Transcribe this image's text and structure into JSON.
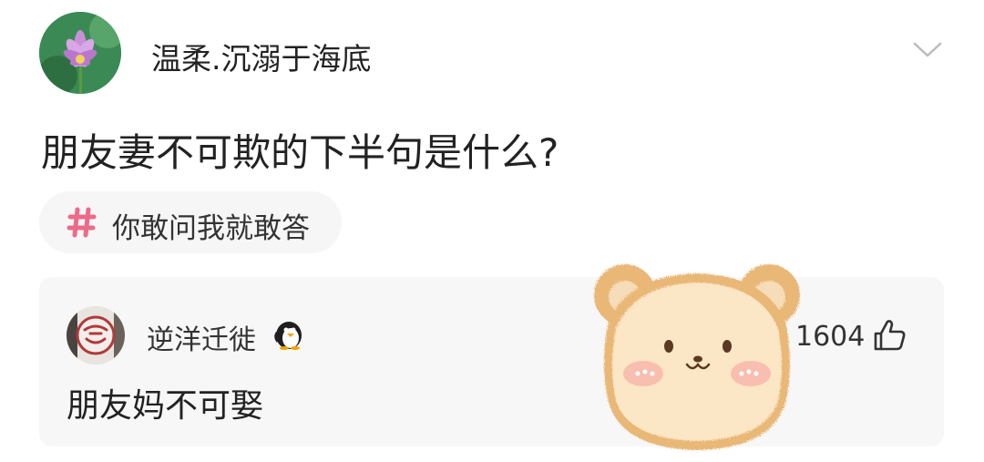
{
  "post": {
    "author": "温柔.沉溺于海底",
    "avatar_icon": "lotus-avatar",
    "question": "朋友妻不可欺的下半句是什么?",
    "topic": {
      "hash_icon": "hash-icon",
      "label": "你敢问我就敢答",
      "accent_color": "#ec6b8b"
    }
  },
  "comment": {
    "author": "逆洋迁徙",
    "avatar_icon": "stamp-avatar",
    "badge_icon": "penguin-icon",
    "text": "朋友妈不可娶",
    "likes": "1604",
    "like_icon": "thumbs-up-icon"
  },
  "sticker": {
    "icon": "bear-sticker"
  }
}
